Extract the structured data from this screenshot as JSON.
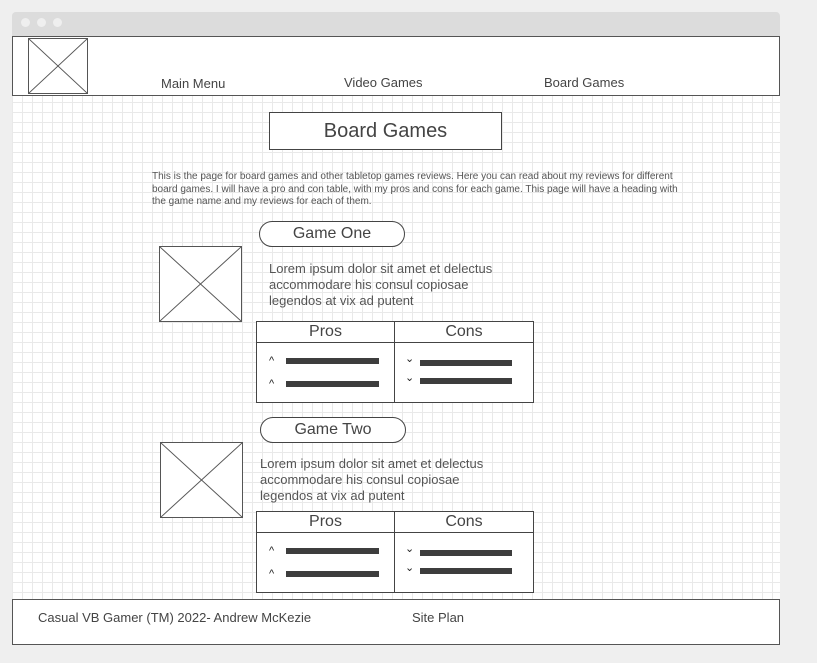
{
  "nav": {
    "main_menu": "Main Menu",
    "video_games": "Video Games",
    "board_games": "Board Games"
  },
  "page": {
    "title": "Board Games",
    "intro": "This is the page for board games and other tabletop games reviews. Here you can read about my reviews for different board games. I will have a pro and con table, with my pros and cons for each game. This page will have a heading with the game name and my reviews for each of them."
  },
  "games": [
    {
      "name": "Game One",
      "description": "Lorem ipsum dolor sit amet et delectus accommodare his consul copiosae legendos at vix ad putent",
      "pros_label": "Pros",
      "cons_label": "Cons"
    },
    {
      "name": "Game Two",
      "description": "Lorem ipsum dolor sit amet et delectus accommodare his consul copiosae legendos at vix ad putent",
      "pros_label": "Pros",
      "cons_label": "Cons"
    }
  ],
  "footer": {
    "copyright": "Casual VB Gamer (TM) 2022- Andrew McKezie",
    "site_plan": "Site Plan"
  },
  "icons": {
    "pro_marker": "chevron-up-icon",
    "con_marker": "chevron-down-icon",
    "image_placeholder": "image-placeholder-icon"
  }
}
